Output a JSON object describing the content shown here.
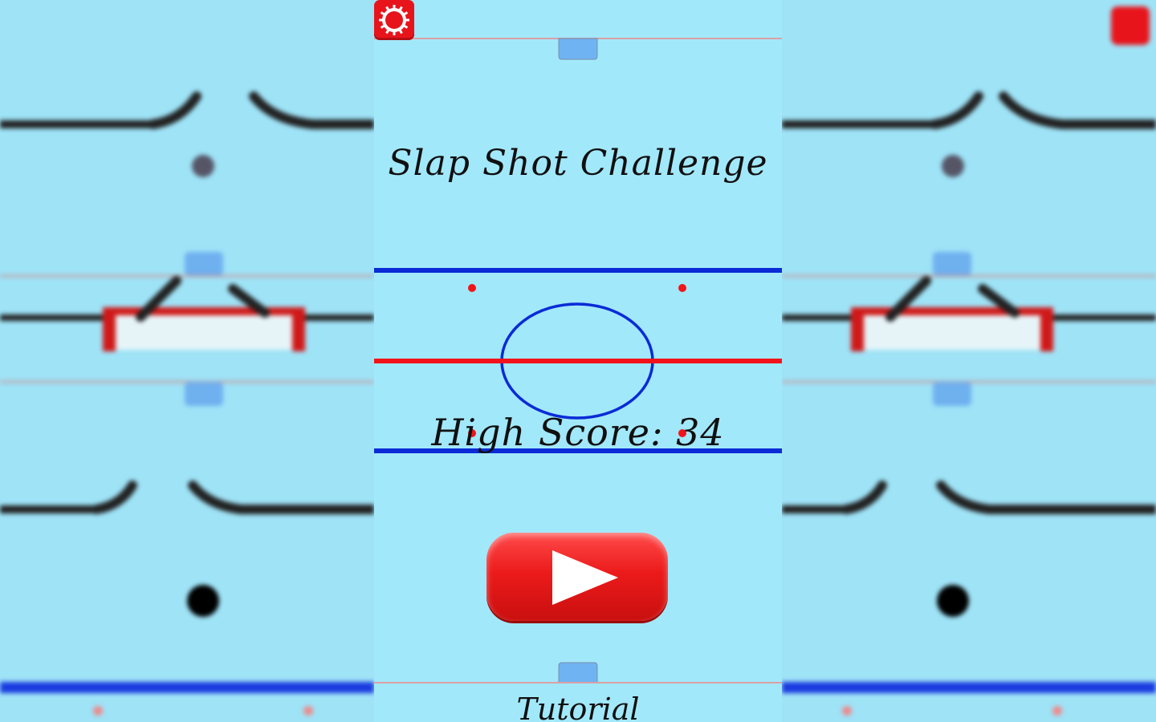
{
  "game": {
    "title": "Slap Shot Challenge",
    "high_score_label": "High Score: 34",
    "tutorial_label": "Tutorial",
    "icons": {
      "settings": "gear-icon",
      "play": "play-icon"
    }
  },
  "colors": {
    "ice": "#a2e8fb",
    "blue_line": "#0a2bd6",
    "red_line": "#f2141a",
    "button_red": "#e8141b"
  }
}
